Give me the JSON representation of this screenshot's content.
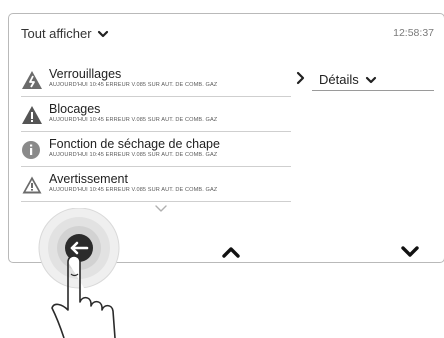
{
  "header": {
    "filter_label": "Tout afficher",
    "time": "12:58:37"
  },
  "messages": [
    {
      "title": "Verrouillages",
      "detail": "AUJOURD'HUI 10:45 ERREUR V.085 SUR AUT. DE COMB. GAZ",
      "icon": "lock-warning-icon",
      "selected": true
    },
    {
      "title": "Blocages",
      "detail": "AUJOURD'HUI 10:45 ERREUR V.085 SUR AUT. DE COMB. GAZ",
      "icon": "warning-filled-icon"
    },
    {
      "title": "Fonction de séchage de chape",
      "detail": "AUJOURD'HUI 10:45 ERREUR V.085 SUR AUT. DE COMB. GAZ",
      "icon": "info-icon"
    },
    {
      "title": "Avertissement",
      "detail": "AUJOURD'HUI 10:45 ERREUR V.085 SUR AUT. DE COMB. GAZ",
      "icon": "warning-outline-icon"
    }
  ],
  "details_label": "Détails",
  "colors": {
    "icon": "#6b6b6b",
    "text": "#222222",
    "border": "#b9b9b9"
  }
}
